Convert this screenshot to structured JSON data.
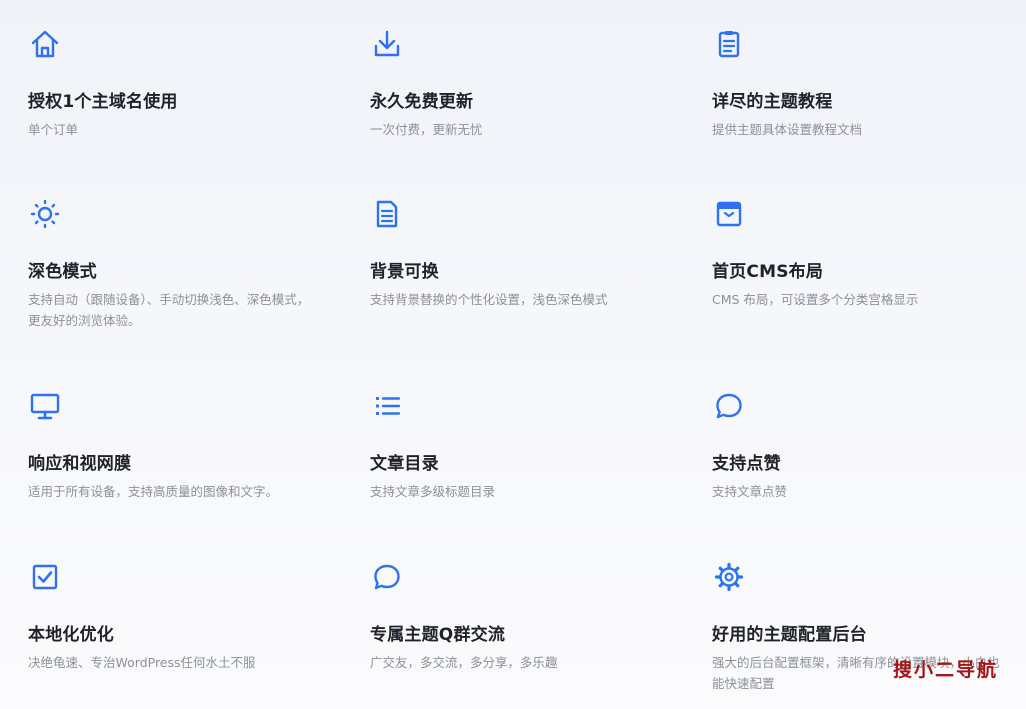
{
  "accent_color": "#2f72f0",
  "features": [
    {
      "icon": "home-icon",
      "title": "授权1个主域名使用",
      "desc": "单个订单"
    },
    {
      "icon": "download-icon",
      "title": "永久免费更新",
      "desc": "一次付费，更新无忧"
    },
    {
      "icon": "clipboard-icon",
      "title": "详尽的主题教程",
      "desc": "提供主题具体设置教程文档"
    },
    {
      "icon": "sun-icon",
      "title": "深色模式",
      "desc": "支持自动（跟随设备）、手动切换浅色、深色模式，更友好的浏览体验。"
    },
    {
      "icon": "document-icon",
      "title": "背景可换",
      "desc": "支持背景替换的个性化设置，浅色深色模式"
    },
    {
      "icon": "layout-icon",
      "title": "首页CMS布局",
      "desc": "CMS 布局，可设置多个分类宫格显示"
    },
    {
      "icon": "monitor-icon",
      "title": "响应和视网膜",
      "desc": "适用于所有设备，支持高质量的图像和文字。"
    },
    {
      "icon": "list-icon",
      "title": "文章目录",
      "desc": "支持文章多级标题目录"
    },
    {
      "icon": "speech-bubble-icon",
      "title": "支持点赞",
      "desc": "支持文章点赞"
    },
    {
      "icon": "checkbox-icon",
      "title": "本地化优化",
      "desc": "决绝龟速、专治WordPress任何水土不服"
    },
    {
      "icon": "chat-icon",
      "title": "专属主题Q群交流",
      "desc": "广交友，多交流，多分享，多乐趣"
    },
    {
      "icon": "gear-icon",
      "title": "好用的主题配置后台",
      "desc": "强大的后台配置框架，清晰有序的设置模块，小白也能快速配置"
    }
  ],
  "watermark": "搜小二导航"
}
